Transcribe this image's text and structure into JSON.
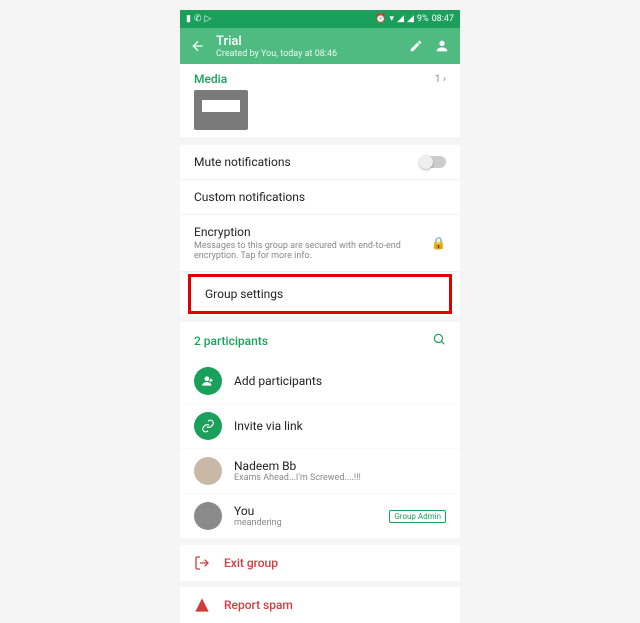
{
  "status": {
    "left_icons": [
      "battery",
      "whatsapp",
      "play"
    ],
    "right_text": "9%",
    "time": "08:47"
  },
  "header": {
    "title": "Trial",
    "subtitle": "Created by You, today at 08:46"
  },
  "media": {
    "label": "Media",
    "count": "1 ›"
  },
  "rows": {
    "mute": "Mute notifications",
    "custom": "Custom notifications",
    "encryption_title": "Encryption",
    "encryption_sub": "Messages to this group are secured with end-to-end encryption. Tap for more info.",
    "group_settings": "Group settings"
  },
  "participants": {
    "header": "2 participants",
    "add": "Add participants",
    "invite": "Invite via link",
    "list": [
      {
        "name": "Nadeem Bb",
        "status": "Exams Ahead...I'm Screwed....!!!",
        "admin": false
      },
      {
        "name": "You",
        "status": "meandering",
        "admin": true
      }
    ],
    "admin_badge": "Group Admin"
  },
  "actions": {
    "exit": "Exit group",
    "report": "Report spam"
  }
}
